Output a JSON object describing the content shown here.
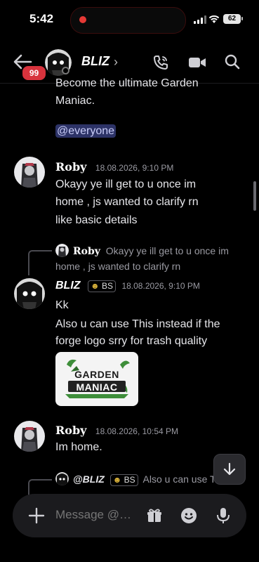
{
  "status_bar": {
    "time": "5:42",
    "battery": "62"
  },
  "header": {
    "badge_count": "99",
    "channel_name": "BLIZ",
    "chevron": "›"
  },
  "messages": {
    "intro_line1": "Become the ultimate Garden",
    "intro_line2": "Maniac.",
    "mention": "@everyone",
    "roby1": {
      "author": "Roby",
      "timestamp": "18.08.2026, 9:10 PM",
      "lines": [
        "Okayy ye ill get to u once im",
        "home , js wanted to clarify rn",
        "like basic details"
      ]
    },
    "reply1": {
      "author": "Roby",
      "line1": "Okayy ye ill get to u once im",
      "line2": "home , js wanted to clarify rn"
    },
    "bliz1": {
      "author": "BLIZ",
      "tag": "BS",
      "timestamp": "18.08.2026, 9:10 PM",
      "line1": "Kk",
      "lines": [
        "Also u can use This instead if the",
        "forge logo srry for trash quality"
      ],
      "image_caption_top": "GARDEN",
      "image_caption_bottom": "MANIAC"
    },
    "roby2": {
      "author": "Roby",
      "timestamp": "18.08.2026, 10:54 PM",
      "line1": "Im home."
    },
    "reply2": {
      "author": "@BLIZ",
      "tag": "BS",
      "text": "Also u can use T"
    }
  },
  "composer": {
    "placeholder": "Message @…"
  },
  "icons": {
    "back": "back-arrow-icon",
    "call": "phone-icon",
    "video": "video-camera-icon",
    "search": "search-icon",
    "add": "plus-icon",
    "gift": "gift-icon",
    "emoji": "emoji-icon",
    "mic": "microphone-icon",
    "jump": "arrow-down-icon"
  },
  "colors": {
    "background": "#000000",
    "badge": "#d8333d",
    "mention": "#2d3367",
    "composer": "#1b1b1e"
  }
}
